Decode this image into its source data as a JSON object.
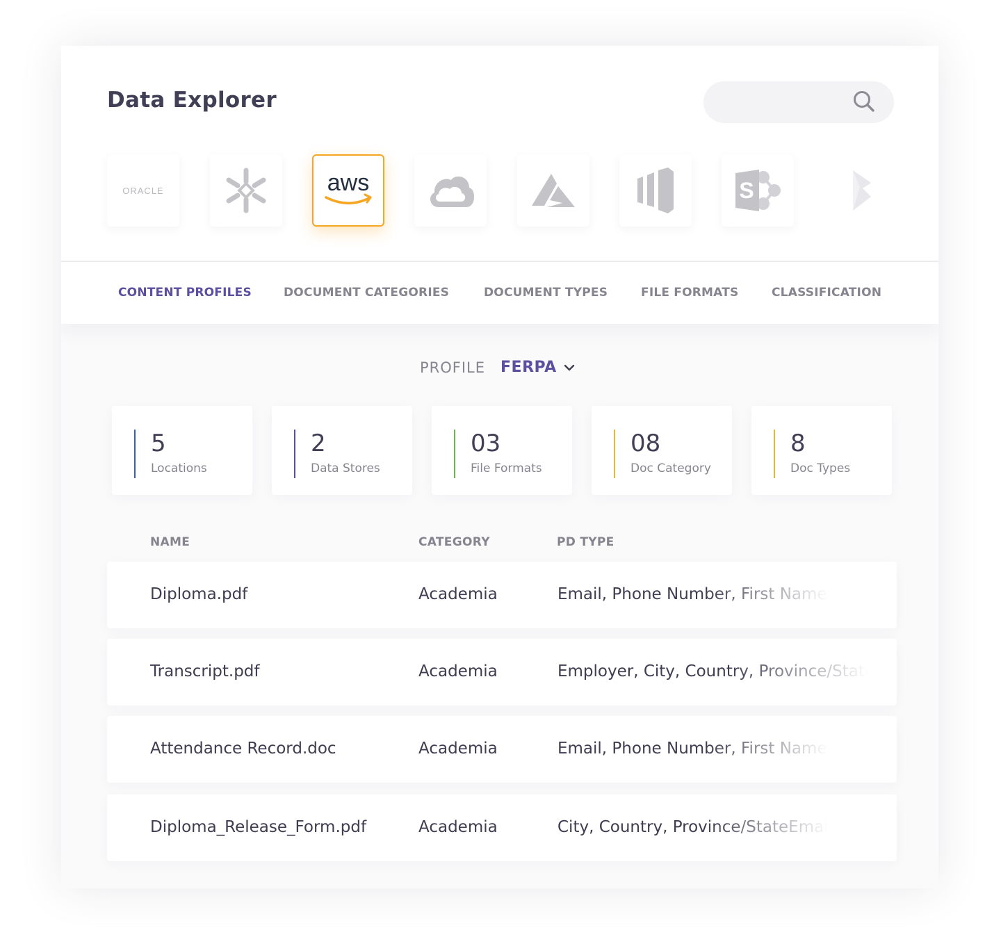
{
  "header": {
    "title": "Data Explorer",
    "search": {
      "placeholder": "",
      "icon": "search-icon"
    }
  },
  "sources": [
    {
      "name": "oracle",
      "label": "ORACLE",
      "icon": "oracle-logo",
      "active": false
    },
    {
      "name": "snowflake",
      "icon": "snowflake-icon",
      "active": false
    },
    {
      "name": "aws",
      "label": "aws",
      "icon": "aws-logo",
      "active": true,
      "accent": "#f5a623"
    },
    {
      "name": "google-cloud",
      "icon": "cloud-icon",
      "active": false
    },
    {
      "name": "azure",
      "icon": "azure-icon",
      "active": false
    },
    {
      "name": "bars",
      "icon": "bars-logo-icon",
      "active": false
    },
    {
      "name": "sharepoint",
      "label": "S",
      "icon": "sharepoint-icon",
      "active": false
    },
    {
      "name": "dynamics",
      "icon": "dynamics-icon",
      "active": false
    }
  ],
  "tabs": [
    {
      "label": "CONTENT PROFILES",
      "active": true
    },
    {
      "label": "DOCUMENT CATEGORIES",
      "active": false
    },
    {
      "label": "DOCUMENT TYPES",
      "active": false
    },
    {
      "label": "FILE FORMATS",
      "active": false
    },
    {
      "label": "CLASSIFICATION",
      "active": false
    }
  ],
  "profile": {
    "label": "PROFILE",
    "value": "FERPA"
  },
  "stats": [
    {
      "value": "5",
      "label": "Locations",
      "color": "#3d5fa8"
    },
    {
      "value": "2",
      "label": "Data Stores",
      "color": "#5b4d9a"
    },
    {
      "value": "03",
      "label": "File Formats",
      "color": "#6cb34c"
    },
    {
      "value": "08",
      "label": "Doc Category",
      "color": "#e3b92c"
    },
    {
      "value": "8",
      "label": "Doc Types",
      "color": "#e3b92c"
    }
  ],
  "table": {
    "columns": [
      "NAME",
      "CATEGORY",
      "PD TYPE"
    ],
    "rows": [
      {
        "name": "Diploma.pdf",
        "category": "Academia",
        "pd_type": "Email, Phone Number, First Name"
      },
      {
        "name": "Transcript.pdf",
        "category": "Academia",
        "pd_type": "Employer, City, Country, Province/State"
      },
      {
        "name": "Attendance Record.doc",
        "category": "Academia",
        "pd_type": "Email, Phone Number, First Name"
      },
      {
        "name": "Diploma_Release_Form.pdf",
        "category": "Academia",
        "pd_type": "City, Country, Province/StateEmail"
      }
    ]
  },
  "colors": {
    "accent": "#5c4fa0",
    "aws_orange": "#f5a623",
    "muted": "#86858f",
    "logo_gray": "#c4c4c8"
  }
}
